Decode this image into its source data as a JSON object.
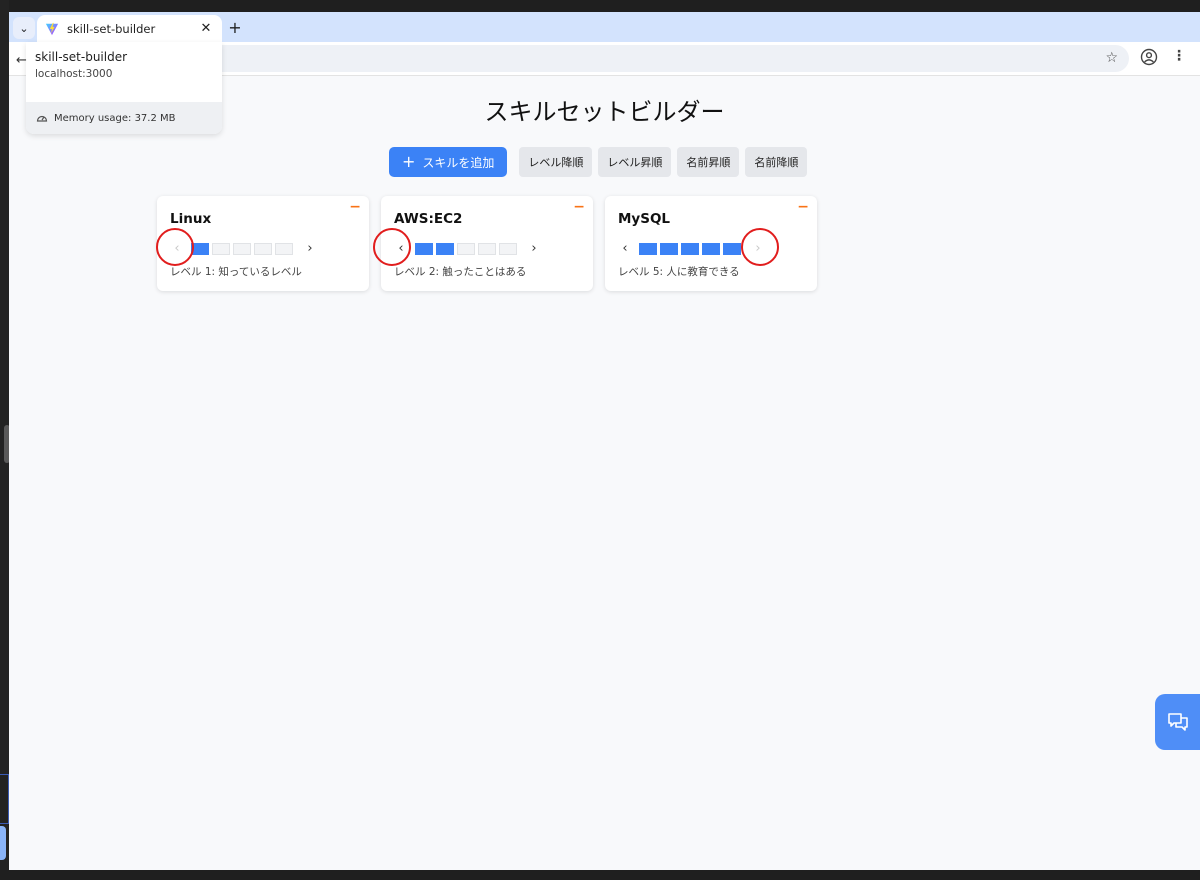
{
  "browser": {
    "tab_title": "skill-set-builder",
    "tab_close": "✕",
    "new_tab": "+",
    "tab_list": "⌄",
    "hovercard": {
      "title": "skill-set-builder",
      "url": "localhost:3000",
      "memory": "Memory usage: 37.2 MB"
    }
  },
  "page": {
    "title": "スキルセットビルダー",
    "add_button": "スキルを追加",
    "sort_buttons": [
      "レベル降順",
      "レベル昇順",
      "名前昇順",
      "名前降順"
    ]
  },
  "skills": [
    {
      "name": "Linux",
      "level": 1,
      "max": 5,
      "desc": "レベル 1: 知っているレベル"
    },
    {
      "name": "AWS:EC2",
      "level": 2,
      "max": 5,
      "desc": "レベル 2: 触ったことはある"
    },
    {
      "name": "MySQL",
      "level": 5,
      "max": 5,
      "desc": "レベル 5: 人に教育できる"
    }
  ],
  "icons": {
    "remove": "−",
    "prev": "‹",
    "next": "›",
    "star": "☆",
    "menu": "⋮",
    "back": "←",
    "plus": "+"
  },
  "colors": {
    "accent": "#3b82f6",
    "remove": "#f97316",
    "highlight_circle": "#e11d1d"
  }
}
